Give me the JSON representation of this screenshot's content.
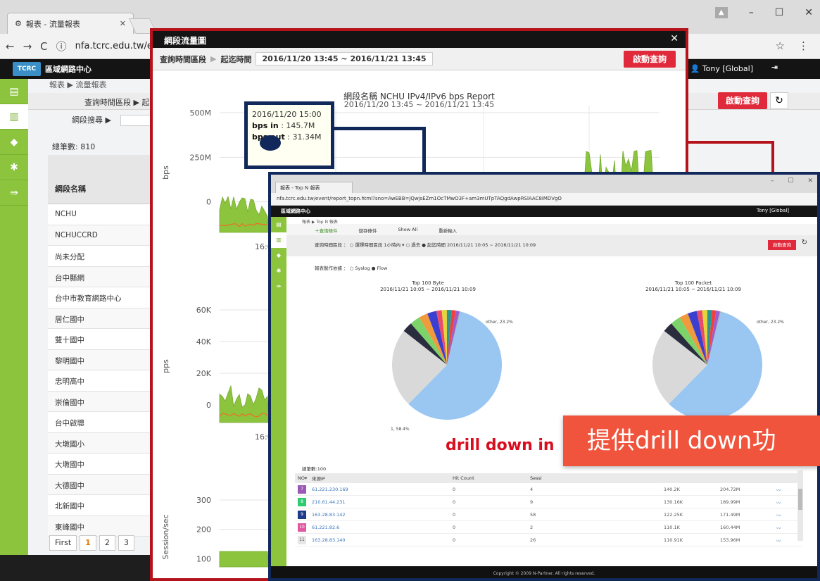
{
  "back_window": {
    "tab_title": "報表 - 流量報表",
    "url": "nfa.tcrc.edu.tw/ev",
    "app_name": "區域網路中心",
    "user": "Tony [Global]",
    "breadcrumb": "報表 ▶ 流量報表",
    "query_label": "查詢時間區段 ▶ 起迄時間",
    "search_label": "網段搜尋 ▶",
    "start_button": "啟動查詢",
    "total": "總筆數: 810",
    "table_header": "網段名稱",
    "rows": [
      "NCHU",
      "NCHUCCRD",
      "尚未分配",
      "台中縣網",
      "台中市教育網路中心",
      "居仁國中",
      "雙十國中",
      "黎明國中",
      "忠明高中",
      "崇倫國中",
      "台中啟聰",
      "大墩國小",
      "大墩國中",
      "大德國中",
      "北新國中",
      "東峰國中"
    ],
    "pager": [
      "First",
      "1",
      "2",
      "3"
    ]
  },
  "popup": {
    "title": "網段流量圖",
    "query_label1": "查詢時間區段",
    "query_label2": "起迄時間",
    "range": "2016/11/20 13:45 ~ 2016/11/21 13:45",
    "start_button": "啟動查詢",
    "chart_title": "網段名稱 NCHU IPv4/IPv6 bps Report",
    "chart_subtitle": "2016/11/20 13:45 ~ 2016/11/21 13:45",
    "tooltip_time": "2016/11/20 15:00",
    "tooltip_in_label": "bps in",
    "tooltip_in": ": 145.7M",
    "tooltip_out_label": "bps out",
    "tooltip_out": ": 31.34M"
  },
  "chart_data": [
    {
      "type": "area",
      "ylabel": "bps",
      "yticks": [
        "500M",
        "250M",
        "0"
      ],
      "xticks": [
        "16:00"
      ],
      "ylim": [
        0,
        500
      ]
    },
    {
      "type": "area",
      "ylabel": "pps",
      "yticks": [
        "60K",
        "40K",
        "20K",
        "0"
      ],
      "xticks": [
        "16:00"
      ],
      "ylim": [
        0,
        60
      ]
    },
    {
      "type": "area",
      "ylabel": "Session/sec",
      "yticks": [
        "300",
        "200",
        "100"
      ],
      "xticks": [],
      "ylim": [
        100,
        300
      ]
    }
  ],
  "front_window": {
    "tab_title": "報表 - Top N 報表",
    "url": "nfa.tcrc.edu.tw/event/report_topn.html?sno=AwEBB=JQwjsEZm1OcTMwO3F+am3mUTpTAQgdAwpRSlAAC8iMDVgO",
    "user": "Tony [Global]",
    "breadcrumb": "報表 ▶ Top N 報表",
    "tabs": [
      "＋查詢條件",
      "儲存條件",
      "Show All",
      "重新輸入"
    ],
    "query_text": "查詢時間區段 ：  ○ 選擇時間區段 1小時內  ▾   ○ 過去  ● 起迄時間  2016/11/21 10:05 ~ 2016/11/21 10:09",
    "source_text": "報表製作依據 ：  ○ Syslog  ● Flow",
    "start_button": "啟動查詢",
    "pie1_title": "Top 100 Byte",
    "pie1_sub": "2016/11/21 10:05 ~ 2016/11/21 10:09",
    "pie2_title": "Top 100 Packet",
    "pie2_sub": "2016/11/21 10:05 ~ 2016/11/21 10:09",
    "pie_other": "other, 23.2%",
    "pie1_big": "1, 58.4%",
    "drill_text": "drill down in",
    "total": "總筆數:100",
    "columns": [
      "NO▾",
      "來源IP",
      "Hit Count",
      "Sessi"
    ],
    "rows": [
      {
        "no": "7",
        "ip": "61.221.230.169",
        "hit": "0",
        "sess": "4",
        "a": "140.2K",
        "b": "204.72M"
      },
      {
        "no": "8",
        "ip": "210.61.44.231",
        "hit": "0",
        "sess": "9",
        "a": "130.16K",
        "b": "189.99M"
      },
      {
        "no": "9",
        "ip": "163.28.83.142",
        "hit": "0",
        "sess": "58",
        "a": "122.25K",
        "b": "171.49M"
      },
      {
        "no": "10",
        "ip": "61.221.82.6",
        "hit": "0",
        "sess": "2",
        "a": "110.1K",
        "b": "160.44M"
      },
      {
        "no": "11",
        "ip": "163.28.83.140",
        "hit": "0",
        "sess": "26",
        "a": "110.91K",
        "b": "153.96M"
      }
    ],
    "footer": "Copyright © 2009 N-Partner. All rights reserved."
  },
  "callout": "提供drill down功"
}
